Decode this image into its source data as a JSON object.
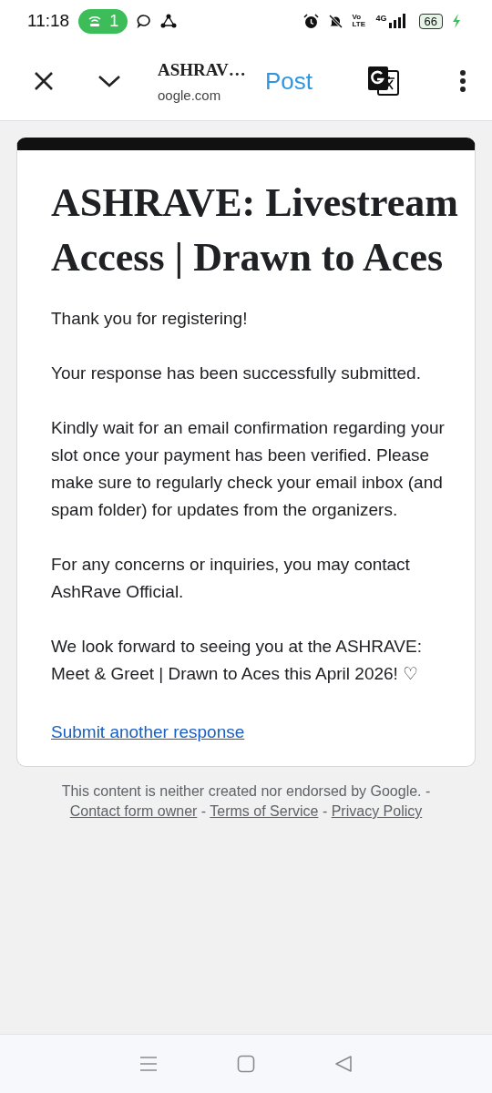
{
  "status_bar": {
    "time": "11:18",
    "hotspot_count": "1",
    "network_type": "4G",
    "volte": "Vo LTE",
    "battery": "66",
    "charging": true
  },
  "toolbar": {
    "title": "ASHRAV…",
    "url": "oogle.com",
    "action": "Post"
  },
  "form": {
    "title": "ASHRAVE: Livestream Access | Drawn to Aces",
    "paragraphs": [
      "Thank you for registering!",
      "Your response has been successfully submitted.",
      "Kindly wait for an email confirmation regarding your slot once your payment has been verified. Please make sure to regularly check your email inbox (and spam folder) for updates from the organizers.",
      "For any concerns or inquiries, you may contact AshRave Official.",
      "We look forward to seeing you at the ASHRAVE: Meet & Greet | Drawn to Aces this April 2026! ♡"
    ],
    "link": "Submit another response"
  },
  "footer": {
    "items": [
      {
        "kind": "text",
        "text": "This content is neither created nor endorsed by Google."
      },
      {
        "kind": "sep",
        "text": "-"
      },
      {
        "kind": "link",
        "text": "Contact form owner"
      },
      {
        "kind": "sep",
        "text": "-"
      },
      {
        "kind": "link",
        "text": "Terms of Service"
      },
      {
        "kind": "sep",
        "text": "-"
      },
      {
        "kind": "link",
        "text": "Privacy Policy"
      }
    ]
  }
}
